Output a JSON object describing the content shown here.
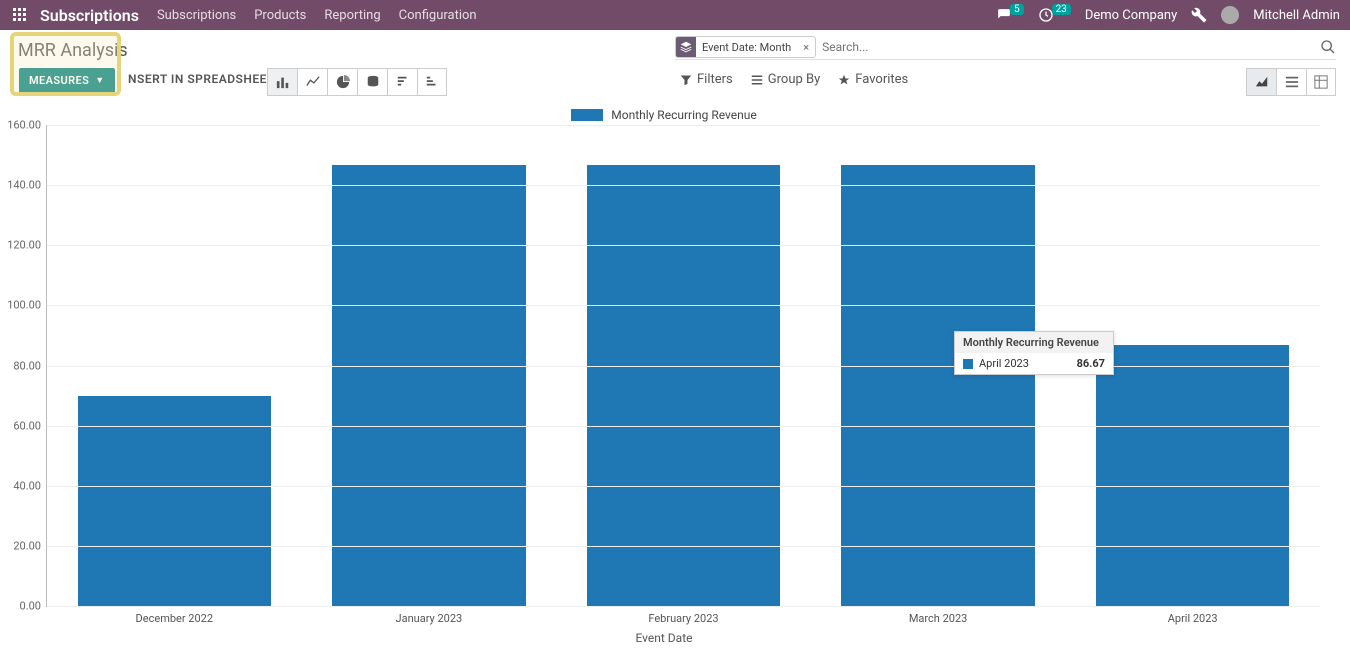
{
  "topnav": {
    "brand": "Subscriptions",
    "menu": [
      "Subscriptions",
      "Products",
      "Reporting",
      "Configuration"
    ],
    "chat_badge": "5",
    "clock_badge": "23",
    "company": "Demo Company",
    "user": "Mitchell Admin"
  },
  "page_title": "MRR Analysis",
  "measures_label": "MEASURES",
  "spreadsheet_label": "NSERT IN SPREADSHEET",
  "search": {
    "tag_label": "Event Date: Month",
    "placeholder": "Search..."
  },
  "filters": {
    "filters": "Filters",
    "groupby": "Group By",
    "favorites": "Favorites"
  },
  "legend_label": "Monthly Recurring Revenue",
  "xlabel": "Event Date",
  "tooltip": {
    "title": "Monthly Recurring Revenue",
    "label": "April 2023",
    "value": "86.67"
  },
  "chart_data": {
    "type": "bar",
    "title": "Monthly Recurring Revenue",
    "xlabel": "Event Date",
    "ylabel": "",
    "ylim": [
      0,
      160
    ],
    "yticks": [
      0,
      20,
      40,
      60,
      80,
      100,
      120,
      140,
      160
    ],
    "categories": [
      "December 2022",
      "January 2023",
      "February 2023",
      "March 2023",
      "April 2023"
    ],
    "series": [
      {
        "name": "Monthly Recurring Revenue",
        "color": "#1f77b4",
        "values": [
          70.0,
          146.67,
          146.67,
          146.67,
          86.67
        ]
      }
    ]
  }
}
